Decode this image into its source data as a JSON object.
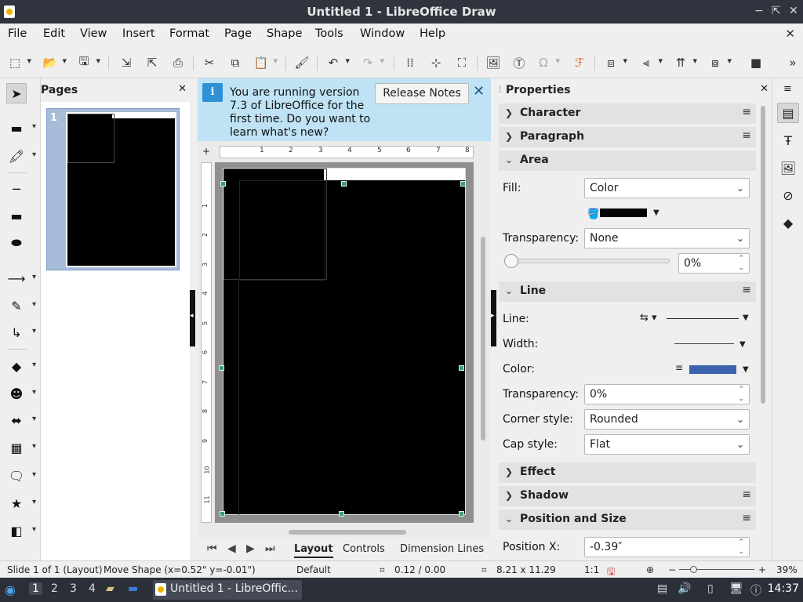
{
  "window": {
    "title": "Untitled 1 - LibreOffice Draw",
    "controls": [
      "−",
      "⇱",
      "✕"
    ]
  },
  "menu": [
    "File",
    "Edit",
    "View",
    "Insert",
    "Format",
    "Page",
    "Shape",
    "Tools",
    "Window",
    "Help"
  ],
  "pages_panel": {
    "title": "Pages",
    "page_number": "1"
  },
  "infobar": {
    "message": "You are running version 7.3 of LibreOffice for the first time. Do you want to learn what's new?",
    "button": "Release Notes"
  },
  "ruler": {
    "h_ticks": [
      "1",
      "2",
      "3",
      "4",
      "5",
      "6",
      "7",
      "8"
    ],
    "v_ticks": [
      "1",
      "2",
      "3",
      "4",
      "5",
      "6",
      "7",
      "8",
      "9",
      "10",
      "11"
    ]
  },
  "bottom_tabs": [
    "Layout",
    "Controls",
    "Dimension Lines"
  ],
  "properties": {
    "title": "Properties",
    "sections": {
      "character": "Character",
      "paragraph": "Paragraph",
      "area": "Area",
      "line": "Line",
      "effect": "Effect",
      "shadow": "Shadow",
      "position_size": "Position and Size"
    },
    "area": {
      "fill_label": "Fill:",
      "fill_value": "Color",
      "fill_color": "#000000",
      "transparency_label": "Transparency:",
      "transparency_value": "None",
      "transparency_pct": "0%"
    },
    "line": {
      "line_label": "Line:",
      "width_label": "Width:",
      "color_label": "Color:",
      "line_color": "#3b62ad",
      "transparency_label": "Transparency:",
      "transparency_value": "0%",
      "corner_label": "Corner style:",
      "corner_value": "Rounded",
      "cap_label": "Cap style:",
      "cap_value": "Flat"
    },
    "position": {
      "x_label": "Position X:",
      "x_value": "-0.39″"
    }
  },
  "statusbar": {
    "slide": "Slide 1 of 1 (Layout)",
    "action": "Move Shape (x=0.52\" y=-0.01\")",
    "master": "Default",
    "position": "0.12 / 0.00",
    "size": "8.21 x 11.29",
    "scale": "1:1",
    "zoom_minus": "−",
    "zoom_plus": "+",
    "zoom": "39%"
  },
  "taskbar": {
    "workspaces": [
      "1",
      "2",
      "3",
      "4"
    ],
    "task_label": "Untitled 1 - LibreOffic...",
    "clock": "14:37"
  }
}
